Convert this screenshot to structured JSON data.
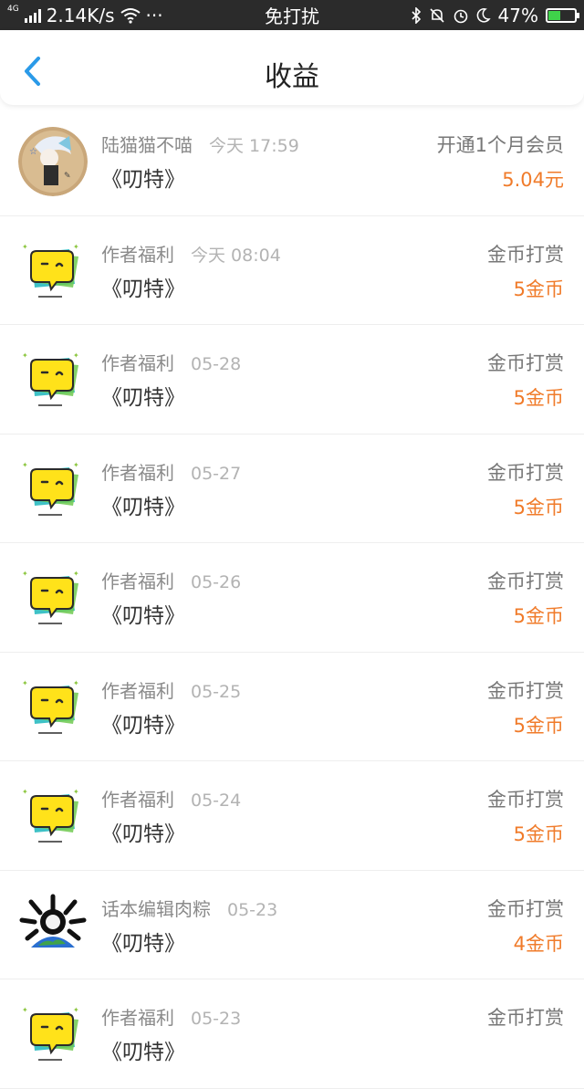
{
  "status": {
    "net": "4G",
    "speed": "2.14K/s",
    "dots": "···",
    "mode": "免打扰",
    "battery": "47%",
    "battery_level": 0.47,
    "accent": "#3fd34a"
  },
  "nav": {
    "title": "收益",
    "back_icon": "chevron-left-icon",
    "accent": "#2a9ae8"
  },
  "rows": [
    {
      "name": "陆猫猫不喵",
      "time": "今天 17:59",
      "book": "《叨特》",
      "type": "开通1个月会员",
      "amount": "5.04元",
      "avatar": "anime"
    },
    {
      "name": "作者福利",
      "time": "今天 08:04",
      "book": "《叨特》",
      "type": "金币打赏",
      "amount": "5金币",
      "avatar": "bubble"
    },
    {
      "name": "作者福利",
      "time": "05-28",
      "book": "《叨特》",
      "type": "金币打赏",
      "amount": "5金币",
      "avatar": "bubble"
    },
    {
      "name": "作者福利",
      "time": "05-27",
      "book": "《叨特》",
      "type": "金币打赏",
      "amount": "5金币",
      "avatar": "bubble"
    },
    {
      "name": "作者福利",
      "time": "05-26",
      "book": "《叨特》",
      "type": "金币打赏",
      "amount": "5金币",
      "avatar": "bubble"
    },
    {
      "name": "作者福利",
      "time": "05-25",
      "book": "《叨特》",
      "type": "金币打赏",
      "amount": "5金币",
      "avatar": "bubble"
    },
    {
      "name": "作者福利",
      "time": "05-24",
      "book": "《叨特》",
      "type": "金币打赏",
      "amount": "5金币",
      "avatar": "bubble"
    },
    {
      "name": "话本编辑肉粽",
      "time": "05-23",
      "book": "《叨特》",
      "type": "金币打赏",
      "amount": "4金币",
      "avatar": "globe"
    },
    {
      "name": "作者福利",
      "time": "05-23",
      "book": "《叨特》",
      "type": "金币打赏",
      "amount": "",
      "avatar": "bubble"
    }
  ],
  "colors": {
    "amount": "#f07b2a",
    "name": "#8a8a8a",
    "time": "#b3b3b3"
  }
}
